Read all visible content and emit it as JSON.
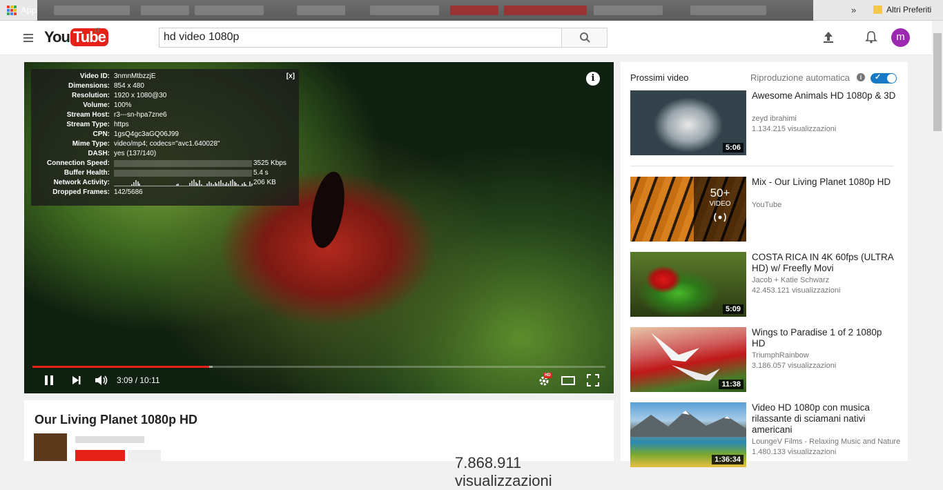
{
  "bookmarks": {
    "apps_label": "App",
    "other_label": "Altri Preferiti"
  },
  "masthead": {
    "logo_you": "You",
    "logo_tube": "Tube",
    "country": "IT",
    "search_value": "hd video 1080p",
    "avatar_letter": "m"
  },
  "player": {
    "stats": [
      {
        "k": "Video ID:",
        "v": "3nmnMtbzzjE"
      },
      {
        "k": "Dimensions:",
        "v": "854 x 480"
      },
      {
        "k": "Resolution:",
        "v": "1920 x 1080@30"
      },
      {
        "k": "Volume:",
        "v": "100%"
      },
      {
        "k": "Stream Host:",
        "v": "r3---sn-hpa7zne6"
      },
      {
        "k": "Stream Type:",
        "v": "https"
      },
      {
        "k": "CPN:",
        "v": "1gsQ4gc3aGQ06J99"
      },
      {
        "k": "Mime Type:",
        "v": "video/mp4; codecs=\"avc1.640028\""
      },
      {
        "k": "DASH:",
        "v": "yes (137/140)"
      }
    ],
    "connection_speed": {
      "label": "Connection Speed:",
      "value": "3525 Kbps",
      "fill": 1.0
    },
    "buffer_health": {
      "label": "Buffer Health:",
      "value": "5.4 s",
      "fill": 0.69
    },
    "network_activity": {
      "label": "Network Activity:",
      "value": "206 KB"
    },
    "dropped": {
      "label": "Dropped Frames:",
      "value": "142/5686"
    },
    "close_label": "[x]",
    "info_label": "i",
    "time": "3:09 / 10:11",
    "played_fraction": 0.309,
    "loaded_fraction": 0.315,
    "hd_badge": "HD"
  },
  "video": {
    "title": "Our Living Planet 1080p HD",
    "views": "7.868.911 visualizzazioni"
  },
  "sidebar": {
    "next_heading": "Prossimi video",
    "autoplay_label": "Riproduzione automatica",
    "items": [
      {
        "title": "Awesome Animals HD 1080p & 3D",
        "channel": "zeyd ibrahimi",
        "views": "1.134.215 visualizzazioni",
        "duration": "5:06"
      },
      {
        "title": "Mix - Our Living Planet 1080p HD",
        "channel": "YouTube",
        "views": "",
        "mix_count": "50+",
        "mix_label": "VIDEO"
      },
      {
        "title": "COSTA RICA IN 4K 60fps (ULTRA HD) w/ Freefly Movi",
        "channel": "Jacob + Katie Schwarz",
        "views": "42.453.121 visualizzazioni",
        "duration": "5:09"
      },
      {
        "title": "Wings to Paradise 1 of 2 1080p HD",
        "channel": "TriumphRainbow",
        "views": "3.186.057 visualizzazioni",
        "duration": "11:38"
      },
      {
        "title": "Video HD 1080p con musica rilassante di sciamani nativi americani",
        "channel": "LoungeV Films - Relaxing Music and Nature",
        "views": "1.480.133 visualizzazioni",
        "duration": "1:36:34"
      }
    ]
  }
}
